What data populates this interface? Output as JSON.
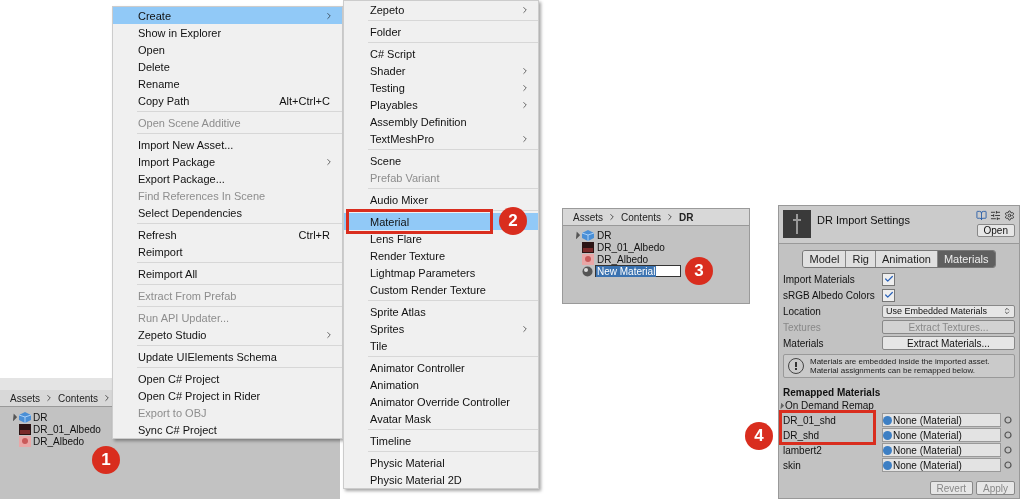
{
  "project_panel": {
    "breadcrumb": [
      "Assets",
      "Contents"
    ],
    "items": [
      {
        "name": "DR",
        "kind": "model"
      },
      {
        "name": "DR_01_Albedo",
        "kind": "dark-texture"
      },
      {
        "name": "DR_Albedo",
        "kind": "light-texture"
      }
    ]
  },
  "step_badge_1": "1",
  "context_menu": {
    "items": [
      {
        "kind": "item",
        "label": "Create",
        "selected": true,
        "disabled": false,
        "submenu": true
      },
      {
        "kind": "item",
        "label": "Show in Explorer",
        "selected": false,
        "disabled": false,
        "submenu": false
      },
      {
        "kind": "item",
        "label": "Open",
        "selected": false,
        "disabled": false,
        "submenu": false
      },
      {
        "kind": "item",
        "label": "Delete",
        "selected": false,
        "disabled": false,
        "submenu": false
      },
      {
        "kind": "item",
        "label": "Rename",
        "selected": false,
        "disabled": false,
        "submenu": false
      },
      {
        "kind": "item",
        "label": "Copy Path",
        "shortcut": "Alt+Ctrl+C",
        "selected": false,
        "disabled": false,
        "submenu": false
      },
      {
        "kind": "separator"
      },
      {
        "kind": "item",
        "label": "Open Scene Additive",
        "selected": false,
        "disabled": true,
        "submenu": false
      },
      {
        "kind": "separator"
      },
      {
        "kind": "item",
        "label": "Import New Asset...",
        "selected": false,
        "disabled": false,
        "submenu": false
      },
      {
        "kind": "item",
        "label": "Import Package",
        "selected": false,
        "disabled": false,
        "submenu": true
      },
      {
        "kind": "item",
        "label": "Export Package...",
        "selected": false,
        "disabled": false,
        "submenu": false
      },
      {
        "kind": "item",
        "label": "Find References In Scene",
        "selected": false,
        "disabled": true,
        "submenu": false
      },
      {
        "kind": "item",
        "label": "Select Dependencies",
        "selected": false,
        "disabled": false,
        "submenu": false
      },
      {
        "kind": "separator"
      },
      {
        "kind": "item",
        "label": "Refresh",
        "shortcut": "Ctrl+R",
        "selected": false,
        "disabled": false,
        "submenu": false
      },
      {
        "kind": "item",
        "label": "Reimport",
        "selected": false,
        "disabled": false,
        "submenu": false
      },
      {
        "kind": "separator"
      },
      {
        "kind": "item",
        "label": "Reimport All",
        "selected": false,
        "disabled": false,
        "submenu": false
      },
      {
        "kind": "separator"
      },
      {
        "kind": "item",
        "label": "Extract From Prefab",
        "selected": false,
        "disabled": true,
        "submenu": false
      },
      {
        "kind": "separator"
      },
      {
        "kind": "item",
        "label": "Run API Updater...",
        "selected": false,
        "disabled": true,
        "submenu": false
      },
      {
        "kind": "item",
        "label": "Zepeto Studio",
        "selected": false,
        "disabled": false,
        "submenu": true
      },
      {
        "kind": "separator"
      },
      {
        "kind": "item",
        "label": "Update UIElements Schema",
        "selected": false,
        "disabled": false,
        "submenu": false
      },
      {
        "kind": "separator"
      },
      {
        "kind": "item",
        "label": "Open C# Project",
        "selected": false,
        "disabled": false,
        "submenu": false
      },
      {
        "kind": "item",
        "label": "Open C# Project in Rider",
        "selected": false,
        "disabled": false,
        "submenu": false
      },
      {
        "kind": "item",
        "label": "Export to OBJ",
        "selected": false,
        "disabled": true,
        "submenu": false
      },
      {
        "kind": "item",
        "label": "Sync C# Project",
        "selected": false,
        "disabled": false,
        "submenu": false
      }
    ]
  },
  "create_submenu": {
    "step_badge": "2",
    "items": [
      {
        "kind": "item",
        "label": "Zepeto",
        "selected": false,
        "disabled": false,
        "submenu": true,
        "highlighted": false
      },
      {
        "kind": "separator"
      },
      {
        "kind": "item",
        "label": "Folder",
        "selected": false,
        "disabled": false,
        "submenu": false,
        "highlighted": false
      },
      {
        "kind": "separator"
      },
      {
        "kind": "item",
        "label": "C# Script",
        "selected": false,
        "disabled": false,
        "submenu": false,
        "highlighted": false
      },
      {
        "kind": "item",
        "label": "Shader",
        "selected": false,
        "disabled": false,
        "submenu": true,
        "highlighted": false
      },
      {
        "kind": "item",
        "label": "Testing",
        "selected": false,
        "disabled": false,
        "submenu": true,
        "highlighted": false
      },
      {
        "kind": "item",
        "label": "Playables",
        "selected": false,
        "disabled": false,
        "submenu": true,
        "highlighted": false
      },
      {
        "kind": "item",
        "label": "Assembly Definition",
        "selected": false,
        "disabled": false,
        "submenu": false,
        "highlighted": false
      },
      {
        "kind": "item",
        "label": "TextMeshPro",
        "selected": false,
        "disabled": false,
        "submenu": true,
        "highlighted": false
      },
      {
        "kind": "separator"
      },
      {
        "kind": "item",
        "label": "Scene",
        "selected": false,
        "disabled": false,
        "submenu": false,
        "highlighted": false
      },
      {
        "kind": "item",
        "label": "Prefab Variant",
        "selected": false,
        "disabled": true,
        "submenu": false,
        "highlighted": false
      },
      {
        "kind": "separator"
      },
      {
        "kind": "item",
        "label": "Audio Mixer",
        "selected": false,
        "disabled": false,
        "submenu": false,
        "highlighted": false
      },
      {
        "kind": "separator"
      },
      {
        "kind": "item",
        "label": "Material",
        "selected": true,
        "disabled": false,
        "submenu": false,
        "highlighted": true
      },
      {
        "kind": "item",
        "label": "Lens Flare",
        "selected": false,
        "disabled": false,
        "submenu": false,
        "highlighted": false
      },
      {
        "kind": "item",
        "label": "Render Texture",
        "selected": false,
        "disabled": false,
        "submenu": false,
        "highlighted": false
      },
      {
        "kind": "item",
        "label": "Lightmap Parameters",
        "selected": false,
        "disabled": false,
        "submenu": false,
        "highlighted": false
      },
      {
        "kind": "item",
        "label": "Custom Render Texture",
        "selected": false,
        "disabled": false,
        "submenu": false,
        "highlighted": false
      },
      {
        "kind": "separator"
      },
      {
        "kind": "item",
        "label": "Sprite Atlas",
        "selected": false,
        "disabled": false,
        "submenu": false,
        "highlighted": false
      },
      {
        "kind": "item",
        "label": "Sprites",
        "selected": false,
        "disabled": false,
        "submenu": true,
        "highlighted": false
      },
      {
        "kind": "item",
        "label": "Tile",
        "selected": false,
        "disabled": false,
        "submenu": false,
        "highlighted": false
      },
      {
        "kind": "separator"
      },
      {
        "kind": "item",
        "label": "Animator Controller",
        "selected": false,
        "disabled": false,
        "submenu": false,
        "highlighted": false
      },
      {
        "kind": "item",
        "label": "Animation",
        "selected": false,
        "disabled": false,
        "submenu": false,
        "highlighted": false
      },
      {
        "kind": "item",
        "label": "Animator Override Controller",
        "selected": false,
        "disabled": false,
        "submenu": false,
        "highlighted": false
      },
      {
        "kind": "item",
        "label": "Avatar Mask",
        "selected": false,
        "disabled": false,
        "submenu": false,
        "highlighted": false
      },
      {
        "kind": "separator"
      },
      {
        "kind": "item",
        "label": "Timeline",
        "selected": false,
        "disabled": false,
        "submenu": false,
        "highlighted": false
      },
      {
        "kind": "separator"
      },
      {
        "kind": "item",
        "label": "Physic Material",
        "selected": false,
        "disabled": false,
        "submenu": false,
        "highlighted": false
      },
      {
        "kind": "item",
        "label": "Physic Material 2D",
        "selected": false,
        "disabled": false,
        "submenu": false,
        "highlighted": false
      }
    ]
  },
  "project_browser": {
    "step_badge": "3",
    "breadcrumb": [
      "Assets",
      "Contents",
      "DR"
    ],
    "items": [
      {
        "name": "DR",
        "kind": "model",
        "selected": false,
        "renaming": false
      },
      {
        "name": "DR_01_Albedo",
        "kind": "dark-texture",
        "selected": false,
        "renaming": false
      },
      {
        "name": "DR_Albedo",
        "kind": "light-texture",
        "selected": false,
        "renaming": false
      },
      {
        "name": "New Material",
        "kind": "material",
        "selected": true,
        "renaming": true
      }
    ]
  },
  "inspector": {
    "title": "DR Import Settings",
    "open_button": "Open",
    "step_badge": "4",
    "tabs": [
      {
        "label": "Model",
        "selected": false
      },
      {
        "label": "Rig",
        "selected": false
      },
      {
        "label": "Animation",
        "selected": false
      },
      {
        "label": "Materials",
        "selected": true
      }
    ],
    "settings": [
      {
        "kind": "checkbox",
        "label": "Import Materials",
        "checked": true,
        "disabled": false
      },
      {
        "kind": "checkbox",
        "label": "sRGB Albedo Colors",
        "checked": true,
        "disabled": false
      },
      {
        "kind": "dropdown",
        "label": "Location",
        "value": "Use Embedded Materials",
        "disabled": false
      },
      {
        "kind": "button",
        "label": "Textures",
        "value": "Extract Textures...",
        "disabled": true
      },
      {
        "kind": "button",
        "label": "Materials",
        "value": "Extract Materials...",
        "disabled": false
      }
    ],
    "info": "Materials are embedded inside the imported asset. Material assignments can be remapped below.",
    "section_title": "Remapped Materials",
    "foldout": {
      "label": "On Demand Remap",
      "expanded": false
    },
    "remap_groups": [
      {
        "highlighted": true,
        "rows": [
          {
            "name": "DR_01_shd",
            "value": "None (Material)"
          },
          {
            "name": "DR_shd",
            "value": "None (Material)"
          }
        ]
      },
      {
        "rows": [
          {
            "name": "lambert2",
            "value": "None (Material)"
          },
          {
            "name": "skin",
            "value": "None (Material)"
          }
        ]
      }
    ],
    "buttons": [
      {
        "label": "Revert",
        "disabled": true
      },
      {
        "label": "Apply",
        "disabled": true
      }
    ]
  }
}
